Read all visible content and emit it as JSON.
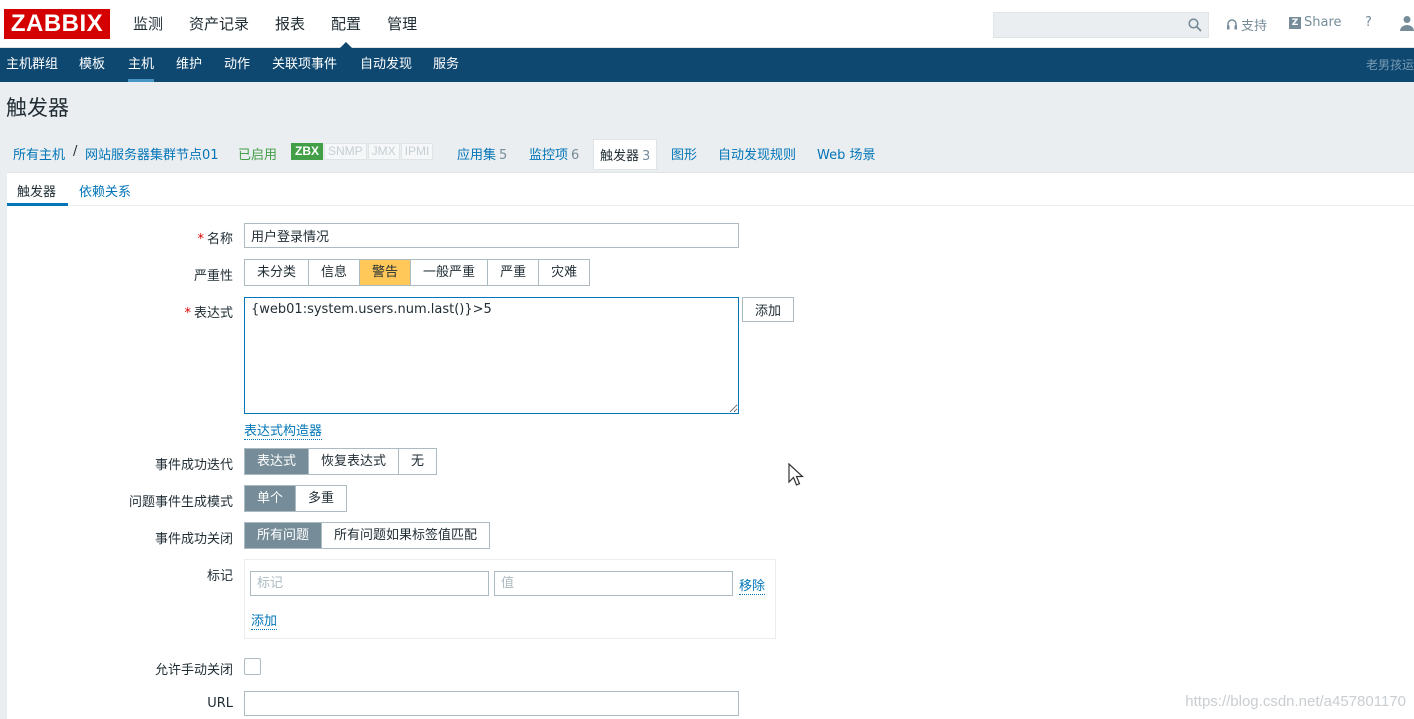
{
  "brand": {
    "logo_text": "ZABBIX",
    "color": "#d40000"
  },
  "top_menu": [
    "监测",
    "资产记录",
    "报表",
    "配置",
    "管理"
  ],
  "top_menu_active": "配置",
  "top_right": {
    "search_placeholder": "",
    "support": "支持",
    "share": "Share",
    "help": "?"
  },
  "sub_nav": {
    "items": [
      "主机群组",
      "模板",
      "主机",
      "维护",
      "动作",
      "关联项事件",
      "自动发现",
      "服务"
    ],
    "active": "主机",
    "user": "老男孩运"
  },
  "page": {
    "title": "触发器"
  },
  "host_bar": {
    "all_hosts": "所有主机",
    "separator": "/",
    "host_name": "网站服务器集群节点01",
    "status": "已启用",
    "availability": [
      "ZBX",
      "SNMP",
      "JMX",
      "IPMI"
    ],
    "links": [
      {
        "label": "应用集",
        "count": "5"
      },
      {
        "label": "监控项",
        "count": "6"
      },
      {
        "label": "触发器",
        "count": "3"
      },
      {
        "label": "图形",
        "count": ""
      },
      {
        "label": "自动发现规则",
        "count": ""
      },
      {
        "label": "Web 场景",
        "count": ""
      }
    ]
  },
  "tabs": [
    "触发器",
    "依赖关系"
  ],
  "form": {
    "name_label": "名称",
    "name_value": "用户登录情况",
    "severity_label": "严重性",
    "severity_options": [
      "未分类",
      "信息",
      "警告",
      "一般严重",
      "严重",
      "灾难"
    ],
    "severity_selected": "警告",
    "expression_label": "表达式",
    "expression_value": "{web01:system.users.num.last()}>5",
    "add_button": "添加",
    "expression_builder": "表达式构造器",
    "ok_event_label": "事件成功迭代",
    "ok_event_options": [
      "表达式",
      "恢复表达式",
      "无"
    ],
    "ok_event_selected": "表达式",
    "problem_mode_label": "问题事件生成模式",
    "problem_mode_options": [
      "单个",
      "多重"
    ],
    "problem_mode_selected": "单个",
    "ok_close_label": "事件成功关闭",
    "ok_close_options": [
      "所有问题",
      "所有问题如果标签值匹配"
    ],
    "ok_close_selected": "所有问题",
    "tags_label": "标记",
    "tag_placeholder": "标记",
    "value_placeholder": "值",
    "remove_link": "移除",
    "add_link": "添加",
    "manual_close_label": "允许手动关闭",
    "manual_close_checked": false,
    "url_label": "URL",
    "url_value": ""
  },
  "watermark": "https://blog.csdn.net/a457801170"
}
